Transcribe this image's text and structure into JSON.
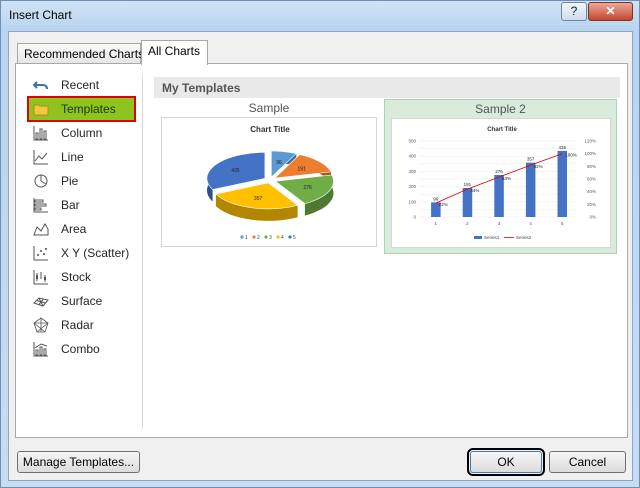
{
  "window": {
    "title": "Insert Chart",
    "help_label": "?",
    "close_label": "✕"
  },
  "tabs": [
    {
      "label": "Recommended Charts",
      "active": false
    },
    {
      "label": "All Charts",
      "active": true
    }
  ],
  "sidebar": {
    "items": [
      {
        "label": "Recent",
        "icon": "undo-icon"
      },
      {
        "label": "Templates",
        "icon": "folder-icon",
        "selected": true
      },
      {
        "label": "Column",
        "icon": "column-chart-icon"
      },
      {
        "label": "Line",
        "icon": "line-chart-icon"
      },
      {
        "label": "Pie",
        "icon": "pie-chart-icon"
      },
      {
        "label": "Bar",
        "icon": "bar-chart-icon"
      },
      {
        "label": "Area",
        "icon": "area-chart-icon"
      },
      {
        "label": "X Y (Scatter)",
        "icon": "scatter-chart-icon"
      },
      {
        "label": "Stock",
        "icon": "stock-chart-icon"
      },
      {
        "label": "Surface",
        "icon": "surface-chart-icon"
      },
      {
        "label": "Radar",
        "icon": "radar-chart-icon"
      },
      {
        "label": "Combo",
        "icon": "combo-chart-icon"
      }
    ]
  },
  "main": {
    "section_title": "My Templates",
    "templates": [
      {
        "name": "Sample"
      },
      {
        "name": "Sample 2"
      }
    ]
  },
  "buttons": {
    "manage": "Manage Templates...",
    "ok": "OK",
    "cancel": "Cancel"
  },
  "colors": {
    "selected_bg": "#8fc31f",
    "selected_outline": "#e00000",
    "blue": "#4472c4",
    "orange": "#ed7d31",
    "gray": "#a5a5a5",
    "gold": "#ffc000",
    "sky": "#5b9bd5",
    "green": "#70ad47",
    "red": "#e00000"
  },
  "chart_data": [
    {
      "type": "pie",
      "title": "Chart Title",
      "categories": [
        "1",
        "2",
        "3",
        "4",
        "5"
      ],
      "values": [
        96,
        191,
        276,
        357,
        435
      ]
    },
    {
      "type": "bar",
      "title": "Chart Title",
      "categories": [
        "1",
        "2",
        "3",
        "4",
        "5"
      ],
      "series": [
        {
          "name": "Series1",
          "values": [
            96,
            191,
            276,
            357,
            435
          ],
          "axis": "primary",
          "kind": "bar"
        },
        {
          "name": "Series2",
          "values": [
            22,
            44,
            63,
            82,
            100
          ],
          "axis": "secondary",
          "kind": "line",
          "data_labels": [
            "22%",
            "44%",
            "63%",
            "82%",
            "100%"
          ]
        }
      ],
      "ylim": [
        0,
        500
      ],
      "y_ticks": [
        "0",
        "50",
        "100",
        "150",
        "200",
        "250",
        "300",
        "350",
        "400",
        "450",
        "500"
      ],
      "y2lim": [
        0,
        120
      ],
      "y2_ticks": [
        "0%",
        "20%",
        "40%",
        "60%",
        "80%",
        "100%",
        "120%"
      ]
    }
  ]
}
